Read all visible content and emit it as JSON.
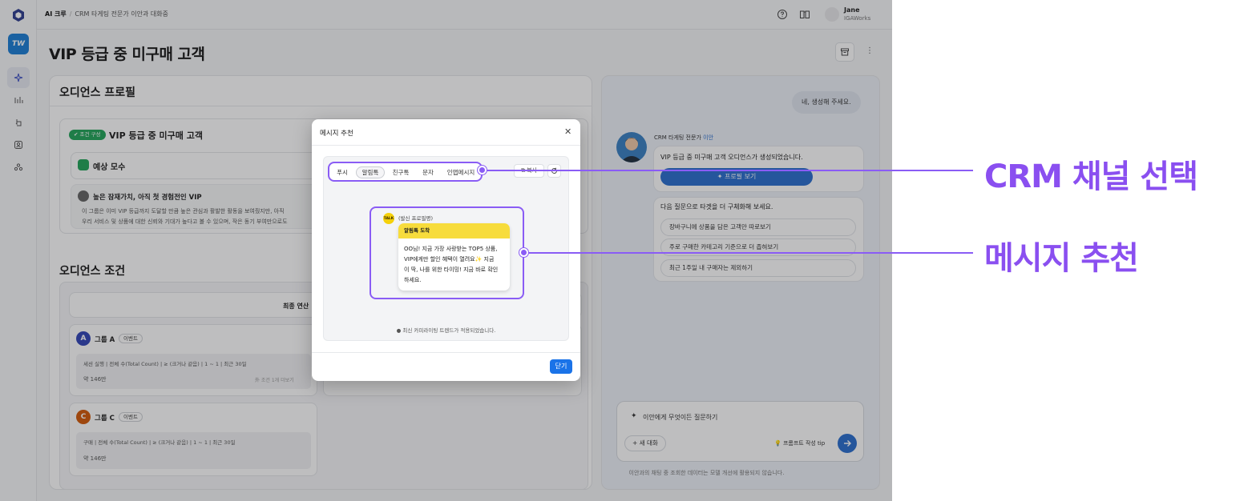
{
  "breadcrumb": {
    "root": "AI 크루",
    "current": "CRM 타게팅 전문가 이안과 대화중"
  },
  "user": {
    "name": "Jane",
    "org": "IGAWorks"
  },
  "workspace": {
    "badge": "TW"
  },
  "page": {
    "title": "VIP 등급 중 미구매 고객"
  },
  "profile": {
    "section_title": "오디언스 프로필",
    "tag": "✔ 조건 구성",
    "name": "VIP 등급 중 미구매 고객",
    "estimate_label": "예상 모수",
    "insight_title": "높은 잠재가치, 아직 첫 경험전인 VIP",
    "insight_line1": "이 그룹은 이미 VIP 등급까지 도달할 만큼 높은 관심과 활발한 활동을 보여줬지만, 아직 ",
    "insight_line2": "우리 서비스 및 상품에 대한 신뢰와 기대가 높다고 볼 수 있으며, 작은 동기 부여만으로도"
  },
  "conditions": {
    "section_title": "오디언스 조건",
    "final_label": "최종 연산",
    "groups": [
      {
        "letter": "A",
        "name": "그룹 A",
        "type": "이벤트",
        "rule": "세션 실행 | 전체 수(Total Count) | ≥ (크거나 같음) | 1 ~ 1 | 최근 30일",
        "count": "약 146만",
        "more": "外 조건 1개 더보기",
        "color": "#3346b8"
      },
      {
        "letter": "C",
        "name": "그룹 C",
        "type": "이벤트",
        "rule": "구매 | 전체 수(Total Count) | ≥ (크거나 같음) | 1 ~ 1 | 최근 30일",
        "count": "약 146만",
        "color": "#d35a0a"
      }
    ]
  },
  "chat": {
    "user_message": "네, 생성해 주세요.",
    "agent_role": "CRM 타게팅 전문가",
    "agent_name": "이안",
    "agent_message": "VIP 등급 중 미구매 고객 오디언스가 생성되었습니다.",
    "profile_button": "프로필 보기",
    "suggest_intro": "다음 질문으로 타겟을 더 구체화해 보세요.",
    "suggestions": [
      "장바구니에 상품을 담은 고객만 따로보기",
      "주로 구매한 카테고리 기준으로 더 좁혀보기",
      "최근 1주일 내 구매자는 제외하기"
    ],
    "input_placeholder": "이안에게 무엇이든 질문하기",
    "new_chat": "새 대화",
    "prompt_tip": "프롬프트 작성 tip",
    "disclaimer": "이안과의 채팅 중 조회한 데이터는 모델 개선에 활용되지 않습니다."
  },
  "modal": {
    "title": "메시지 추천",
    "tabs": [
      "푸시",
      "알림톡",
      "친구톡",
      "문자",
      "인앱메시지"
    ],
    "active_tab": "알림톡",
    "copy_label": "복사",
    "sender": "(발신 프로필명)",
    "kakao_badge": "TALK",
    "message_header": "알림톡 도착",
    "message_body": "OO님! 지금 가장 사랑받는 TOP5 상품,\nVIP에게만 할인 혜택이 열려요✨ 지금\n이 딱, 나를 위한 타이밍! 지금 바로 확인\n하세요.",
    "note": "● 최신 카피라이팅 트렌드가 적용되었습니다.",
    "close_button": "닫기"
  },
  "callouts": {
    "channel": "CRM 채널 선택",
    "message": "메시지 추천"
  },
  "colors": {
    "accent": "#8a5cf5",
    "primary": "#1a73e8",
    "kakao": "#f7dc3c"
  }
}
